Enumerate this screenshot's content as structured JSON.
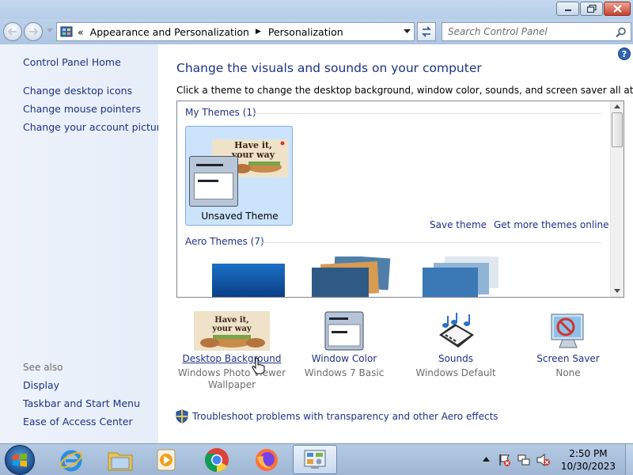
{
  "window": {
    "min_label": "minimize",
    "max_label": "maximize",
    "close_label": "close"
  },
  "address": {
    "overflow_glyph": "«",
    "crumbs": [
      "Appearance and Personalization",
      "Personalization"
    ],
    "separator": "▶"
  },
  "search": {
    "placeholder": "Search Control Panel"
  },
  "left_pane": {
    "home": "Control Panel Home",
    "links": [
      "Change desktop icons",
      "Change mouse pointers",
      "Change your account picture"
    ],
    "see_also_label": "See also",
    "see_also": [
      "Display",
      "Taskbar and Start Menu",
      "Ease of Access Center"
    ]
  },
  "main": {
    "heading": "Change the visuals and sounds on your computer",
    "subheading": "Click a theme to change the desktop background, window color, sounds, and screen saver all at once.",
    "my_themes_label": "My Themes (1)",
    "unsaved_theme": "Unsaved Theme",
    "thumb_caption": "Have it, your way",
    "save_theme": "Save theme",
    "get_more": "Get more themes online",
    "aero_themes_label": "Aero Themes (7)"
  },
  "settings": [
    {
      "title": "Desktop Background",
      "sub1": "Windows Photo Viewer",
      "sub2": "Wallpaper",
      "icon": "desktop-background-icon"
    },
    {
      "title": "Window Color",
      "sub1": "Windows 7 Basic",
      "sub2": "",
      "icon": "window-color-icon"
    },
    {
      "title": "Sounds",
      "sub1": "Windows Default",
      "sub2": "",
      "icon": "sounds-icon"
    },
    {
      "title": "Screen Saver",
      "sub1": "None",
      "sub2": "",
      "icon": "screen-saver-icon"
    }
  ],
  "troubleshoot": "Troubleshoot problems with transparency and other Aero effects",
  "taskbar": {
    "apps": [
      "internet-explorer",
      "file-explorer",
      "media-player",
      "chrome",
      "firefox",
      "control-panel"
    ],
    "time": "2:50 PM",
    "date": "10/30/2023"
  },
  "colors": {
    "link": "#1e3287",
    "left_pane_bg": "#e5edf8",
    "selected_tile": "#cce4fb"
  }
}
